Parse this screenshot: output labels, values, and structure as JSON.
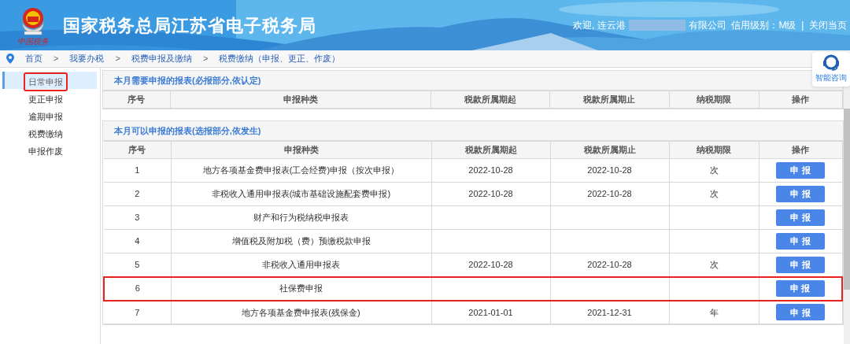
{
  "header": {
    "title": "国家税务总局江苏省电子税务局",
    "logo_caption": "中国税务",
    "welcome": "欢迎, 连云港",
    "company_suffix": "有限公司",
    "credit": "信用级别：M级",
    "divider": "|",
    "close": "关闭当页"
  },
  "breadcrumb": [
    {
      "kind": "link",
      "label": "首页"
    },
    {
      "kind": "separator",
      "label": ">"
    },
    {
      "kind": "link",
      "label": "我要办税"
    },
    {
      "kind": "separator",
      "label": ">"
    },
    {
      "kind": "link",
      "label": "税费申报及缴纳"
    },
    {
      "kind": "separator",
      "label": ">"
    },
    {
      "kind": "link",
      "label": "税费缴纳（申报、更正、作废）"
    }
  ],
  "assistant": {
    "label": "智能咨询"
  },
  "sidebar": {
    "items": [
      {
        "label": "日常申报",
        "selected": true,
        "highlighted": true
      },
      {
        "label": "更正申报",
        "selected": false,
        "highlighted": false
      },
      {
        "label": "逾期申报",
        "selected": false,
        "highlighted": false
      },
      {
        "label": "税费缴纳",
        "selected": false,
        "highlighted": false
      },
      {
        "label": "申报作废",
        "selected": false,
        "highlighted": false
      }
    ]
  },
  "sections": [
    {
      "title": "本月需要申报的报表(必报部分,依认定)",
      "columns": [
        "序号",
        "申报种类",
        "税款所属期起",
        "税款所属期止",
        "纳税期限",
        "操作"
      ]
    },
    {
      "title": "本月可以申报的报表(选报部分,依发生)",
      "columns": [
        "序号",
        "申报种类",
        "税款所属期起",
        "税款所属期止",
        "纳税期限",
        "操作"
      ],
      "rows": [
        {
          "cells": [
            "1",
            "地方各项基金费申报表(工会经费)申报（按次申报）",
            "2022-10-28",
            "2022-10-28",
            "次"
          ],
          "action": "申 报",
          "highlighted": false
        },
        {
          "cells": [
            "2",
            "非税收入通用申报表(城市基础设施配套费申报)",
            "2022-10-28",
            "2022-10-28",
            "次"
          ],
          "action": "申 报",
          "highlighted": false
        },
        {
          "cells": [
            "3",
            "财产和行为税纳税申报表",
            "",
            "",
            ""
          ],
          "action": "申 报",
          "highlighted": false
        },
        {
          "cells": [
            "4",
            "增值税及附加税（费）预缴税款申报",
            "",
            "",
            ""
          ],
          "action": "申 报",
          "highlighted": false
        },
        {
          "cells": [
            "5",
            "非税收入通用申报表",
            "2022-10-28",
            "2022-10-28",
            "次"
          ],
          "action": "申 报",
          "highlighted": false
        },
        {
          "cells": [
            "6",
            "社保费申报",
            "",
            "",
            ""
          ],
          "action": "申 报",
          "highlighted": true
        },
        {
          "cells": [
            "7",
            "地方各项基金费申报表(残保金)",
            "2021-01-01",
            "2021-12-31",
            "年"
          ],
          "action": "申 报",
          "highlighted": false
        }
      ]
    }
  ]
}
